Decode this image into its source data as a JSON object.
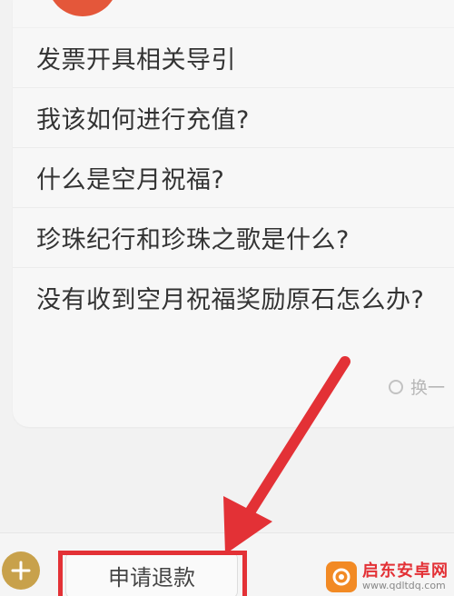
{
  "faq": {
    "items": [
      "发票开具相关导引",
      "我该如何进行充值?",
      "什么是空月祝福?",
      "珍珠纪行和珍珠之歌是什么?",
      "没有收到空月祝福奖励原石怎么办?"
    ],
    "more_label": "换一"
  },
  "bottom_bar": {
    "refund_label": "申请退款"
  },
  "watermark": {
    "name": "启东安卓网",
    "url": "www.qdltdq.com"
  },
  "colors": {
    "accent_red": "#e33136",
    "avatar": "#e4573a",
    "plus_button": "#c8a14b"
  }
}
